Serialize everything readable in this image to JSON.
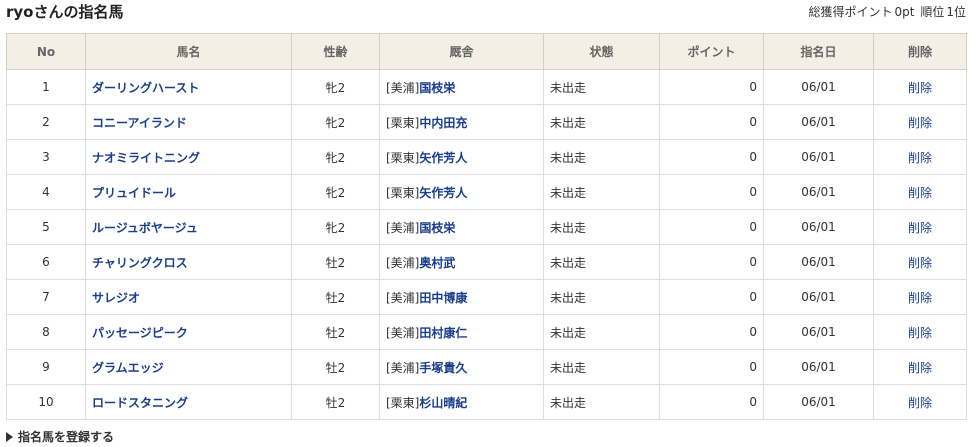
{
  "page": {
    "title": "ryoさんの指名馬",
    "summary": {
      "label": "総獲得ポイント",
      "points": "0pt",
      "rank_label": "順位",
      "rank": "1位"
    }
  },
  "table": {
    "headers": {
      "no": "No",
      "name": "馬名",
      "sexage": "性齢",
      "stable": "厩舎",
      "status": "状態",
      "points": "ポイント",
      "date": "指名日",
      "delete": "削除"
    },
    "rows": [
      {
        "no": "1",
        "name": "ダーリングハースト",
        "sexage": "牝2",
        "region": "[美浦]",
        "trainer": "国枝栄",
        "status": "未出走",
        "points": "0",
        "date": "06/01",
        "delete": "削除"
      },
      {
        "no": "2",
        "name": "コニーアイランド",
        "sexage": "牝2",
        "region": "[栗東]",
        "trainer": "中内田充",
        "status": "未出走",
        "points": "0",
        "date": "06/01",
        "delete": "削除"
      },
      {
        "no": "3",
        "name": "ナオミライトニング",
        "sexage": "牝2",
        "region": "[栗東]",
        "trainer": "矢作芳人",
        "status": "未出走",
        "points": "0",
        "date": "06/01",
        "delete": "削除"
      },
      {
        "no": "4",
        "name": "プリュイドール",
        "sexage": "牝2",
        "region": "[栗東]",
        "trainer": "矢作芳人",
        "status": "未出走",
        "points": "0",
        "date": "06/01",
        "delete": "削除"
      },
      {
        "no": "5",
        "name": "ルージュボヤージュ",
        "sexage": "牝2",
        "region": "[美浦]",
        "trainer": "国枝栄",
        "status": "未出走",
        "points": "0",
        "date": "06/01",
        "delete": "削除"
      },
      {
        "no": "6",
        "name": "チャリングクロス",
        "sexage": "牡2",
        "region": "[美浦]",
        "trainer": "奥村武",
        "status": "未出走",
        "points": "0",
        "date": "06/01",
        "delete": "削除"
      },
      {
        "no": "7",
        "name": "サレジオ",
        "sexage": "牡2",
        "region": "[美浦]",
        "trainer": "田中博康",
        "status": "未出走",
        "points": "0",
        "date": "06/01",
        "delete": "削除"
      },
      {
        "no": "8",
        "name": "パッセージピーク",
        "sexage": "牡2",
        "region": "[美浦]",
        "trainer": "田村康仁",
        "status": "未出走",
        "points": "0",
        "date": "06/01",
        "delete": "削除"
      },
      {
        "no": "9",
        "name": "グラムエッジ",
        "sexage": "牡2",
        "region": "[美浦]",
        "trainer": "手塚貴久",
        "status": "未出走",
        "points": "0",
        "date": "06/01",
        "delete": "削除"
      },
      {
        "no": "10",
        "name": "ロードスタニング",
        "sexage": "牡2",
        "region": "[栗東]",
        "trainer": "杉山晴紀",
        "status": "未出走",
        "points": "0",
        "date": "06/01",
        "delete": "削除"
      }
    ]
  },
  "footer": {
    "register_label": "指名馬を登録する",
    "register_icon": "triangle-right-icon"
  },
  "colors": {
    "header_bg": "#f3efe4",
    "link": "#1a3d8c",
    "border": "#dddddd"
  }
}
